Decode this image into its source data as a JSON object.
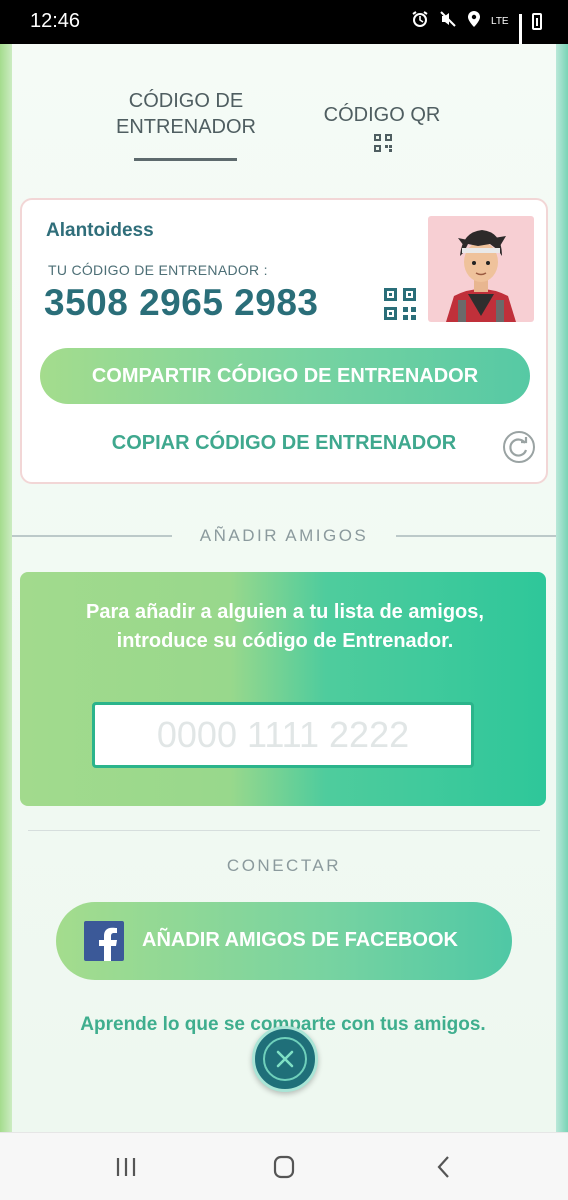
{
  "status_bar": {
    "time": "12:46",
    "network": "LTE",
    "icons": [
      "alarm-icon",
      "mute-icon",
      "location-icon",
      "lte-icon",
      "signal-icon",
      "battery-icon"
    ]
  },
  "tabs": [
    {
      "line1": "CÓDIGO DE",
      "line2": "ENTRENADOR",
      "selected": true
    },
    {
      "label": "CÓDIGO QR",
      "selected": false
    }
  ],
  "trainer_card": {
    "username": "Alantoidess",
    "code_label": "TU CÓDIGO DE ENTRENADOR :",
    "code": "3508 2965 2983",
    "share_label": "COMPARTIR CÓDIGO DE ENTRENADOR",
    "copy_label": "COPIAR CÓDIGO DE ENTRENADOR"
  },
  "add_friends": {
    "heading": "AÑADIR AMIGOS",
    "instructions": "Para añadir a alguien a tu lista de amigos, introduce su código de Entrenador.",
    "input_value": "",
    "input_placeholder": "0000 1111 2222"
  },
  "connect": {
    "heading": "CONECTAR",
    "facebook_label": "AÑADIR AMIGOS DE FACEBOOK",
    "learn_more": "Aprende lo que se comparte con tus amigos."
  },
  "colors": {
    "accent_green": "#a4dc8d",
    "accent_teal": "#2ec79a",
    "code_text": "#2a6e79",
    "close_button": "#1f6f79",
    "facebook_blue": "#3b5998"
  },
  "nav_bar": {
    "buttons": [
      "recent-apps-icon",
      "home-icon",
      "back-icon"
    ]
  }
}
